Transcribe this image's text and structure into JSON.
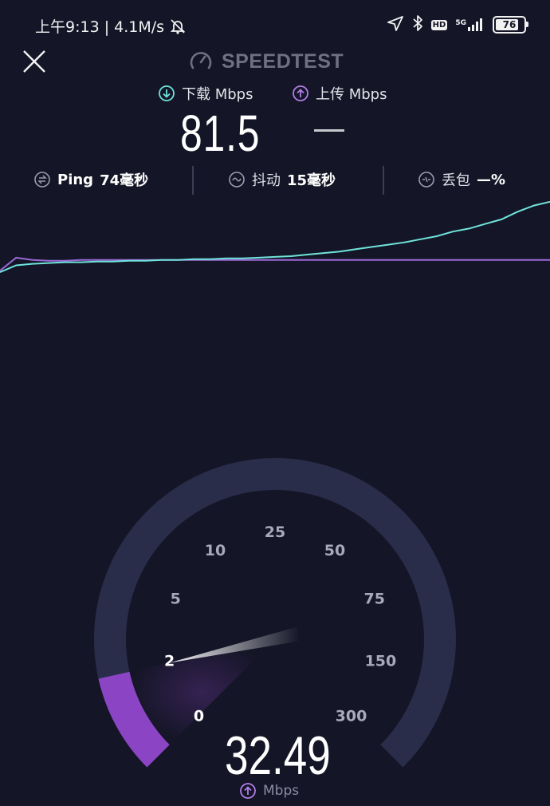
{
  "status_bar": {
    "time": "上午9:13",
    "net_speed": "4.1M/s",
    "network_type": "5G",
    "hd_badge": "HD",
    "battery": "76"
  },
  "header": {
    "brand": "SPEEDTEST"
  },
  "results": {
    "download_label": "下载 Mbps",
    "upload_label": "上传 Mbps",
    "download_value": "81.5",
    "upload_value": ""
  },
  "stats": {
    "ping_label": "Ping",
    "ping_value": "74毫秒",
    "jitter_label": "抖动",
    "jitter_value": "15毫秒",
    "loss_label": "丢包",
    "loss_value": "—%"
  },
  "graph": {
    "download_color": "#6fe4dc",
    "upload_color": "#9b6ad8",
    "download_series": [
      0.03,
      0.12,
      0.14,
      0.15,
      0.16,
      0.16,
      0.17,
      0.17,
      0.18,
      0.18,
      0.19,
      0.19,
      0.2,
      0.2,
      0.21,
      0.21,
      0.22,
      0.23,
      0.24,
      0.26,
      0.28,
      0.3,
      0.33,
      0.36,
      0.39,
      0.42,
      0.46,
      0.5,
      0.56,
      0.6,
      0.66,
      0.72,
      0.82,
      0.9,
      0.95
    ],
    "upload_series": [
      0.05,
      0.22,
      0.19,
      0.18,
      0.18,
      0.19,
      0.19,
      0.19,
      0.19,
      0.19,
      0.19,
      0.19,
      0.19,
      0.19,
      0.19,
      0.19,
      0.19,
      0.19,
      0.19,
      0.19,
      0.19,
      0.19,
      0.19,
      0.19,
      0.19,
      0.19,
      0.19,
      0.19,
      0.19,
      0.19,
      0.19,
      0.19,
      0.19,
      0.19,
      0.19
    ]
  },
  "gauge": {
    "ticks": [
      "0",
      "2",
      "5",
      "10",
      "25",
      "50",
      "75",
      "150",
      "300"
    ],
    "current_value": "32.49",
    "unit": "Mbps",
    "progress_fraction": 0.12,
    "track_color": "#2a2d4a",
    "active_color": "#8b45c4"
  }
}
